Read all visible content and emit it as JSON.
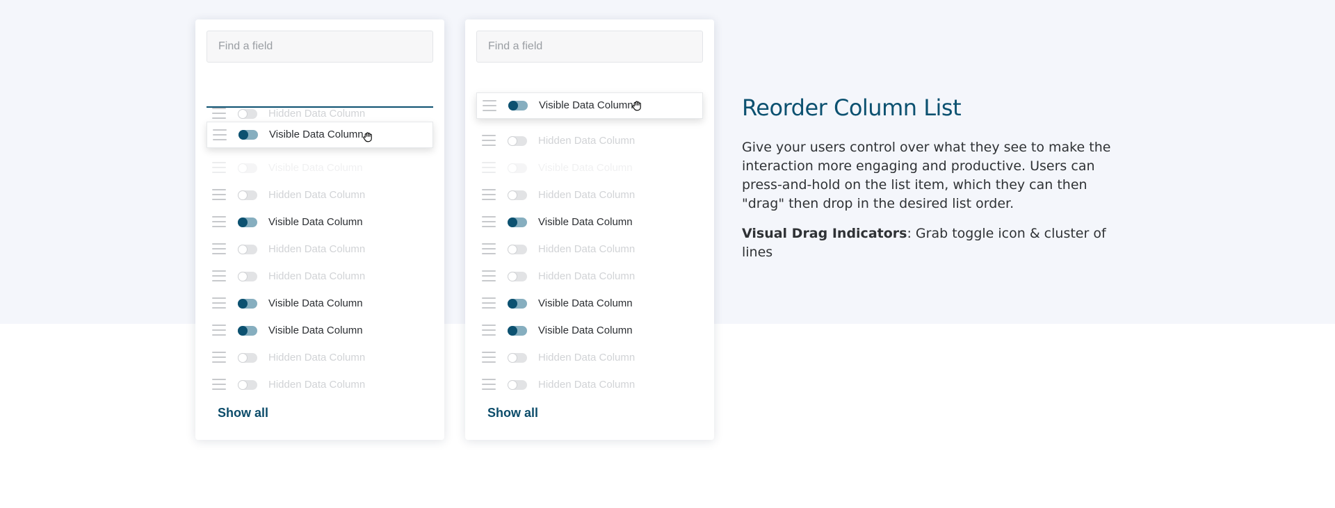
{
  "colors": {
    "accent": "#0c5170",
    "toggle_on_track": "#86aebf",
    "toggle_off_track": "#e2e3e5",
    "background_top": "#f4f6fb"
  },
  "icons": {
    "drag_handle": "hamburger-lines-icon",
    "toggle": "toggle-switch-icon",
    "cursor": "grab-hand-cursor-icon"
  },
  "panels": [
    {
      "search_placeholder": "Find a field",
      "show_all_label": "Show all",
      "dragged_item": {
        "label": "Visible Data Column",
        "visible": true
      },
      "items": [
        {
          "label": "Hidden Data Column",
          "visible": false
        },
        {
          "label": "Hidden Data Column",
          "visible": false
        },
        {
          "label": "Visible Data Column",
          "visible": false
        },
        {
          "label": "Hidden Data Column",
          "visible": false
        },
        {
          "label": "Visible Data Column",
          "visible": true
        },
        {
          "label": "Hidden Data Column",
          "visible": false
        },
        {
          "label": "Hidden Data Column",
          "visible": false
        },
        {
          "label": "Visible Data Column",
          "visible": true
        },
        {
          "label": "Visible Data Column",
          "visible": true
        },
        {
          "label": "Hidden Data Column",
          "visible": false
        },
        {
          "label": "Hidden Data Column",
          "visible": false
        }
      ]
    },
    {
      "search_placeholder": "Find a field",
      "show_all_label": "Show all",
      "dragged_item": {
        "label": "Visible Data Column",
        "visible": true
      },
      "items": [
        {
          "label": "Hidden Data Column",
          "visible": false
        },
        {
          "label": "Hidden Data Column",
          "visible": false
        },
        {
          "label": "Visible Data Column",
          "visible": false
        },
        {
          "label": "Hidden Data Column",
          "visible": false
        },
        {
          "label": "Visible Data Column",
          "visible": true
        },
        {
          "label": "Hidden Data Column",
          "visible": false
        },
        {
          "label": "Hidden Data Column",
          "visible": false
        },
        {
          "label": "Visible Data Column",
          "visible": true
        },
        {
          "label": "Visible Data Column",
          "visible": true
        },
        {
          "label": "Hidden Data Column",
          "visible": false
        },
        {
          "label": "Hidden Data Column",
          "visible": false
        }
      ]
    }
  ],
  "info": {
    "title": "Reorder Column List",
    "description": "Give your users control over what they see to make the interaction more engaging and productive. Users can press-and-hold on the list item, which they can then \"drag\" then drop in the desired list order.",
    "indicators_label": "Visual Drag Indicators",
    "indicators_text": ": Grab toggle icon & cluster of lines"
  }
}
